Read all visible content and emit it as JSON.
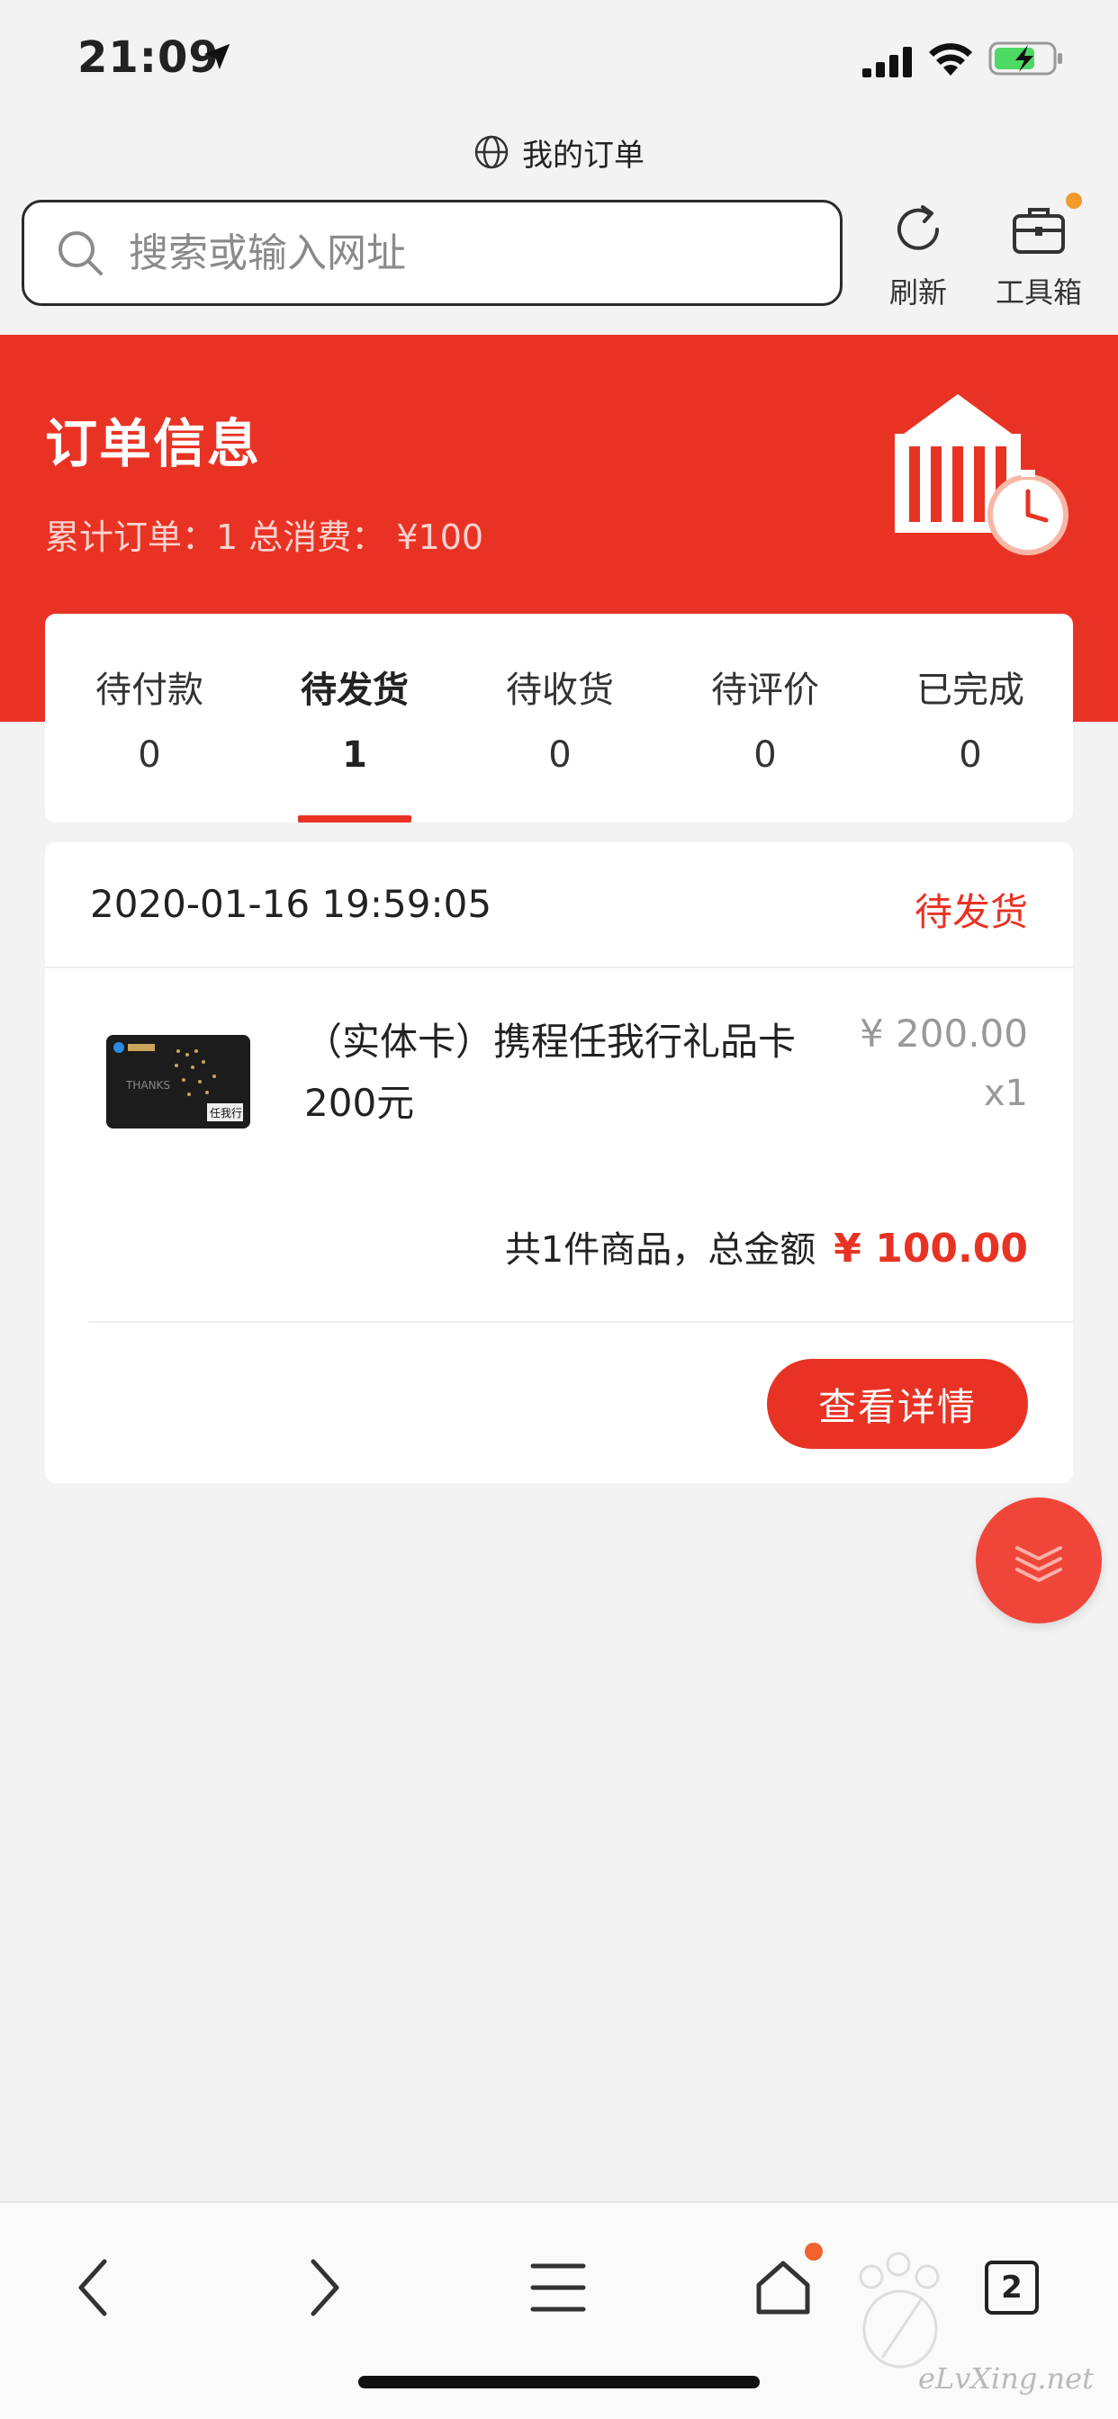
{
  "status_bar": {
    "time": "21:09"
  },
  "browser": {
    "page_title": "我的订单",
    "search_placeholder": "搜索或输入网址",
    "refresh_label": "刷新",
    "toolbox_label": "工具箱",
    "tab_count": "2"
  },
  "header": {
    "title": "订单信息",
    "summary": "累计订单：1 总消费： ¥100"
  },
  "tabs": [
    {
      "label": "待付款",
      "count": "0"
    },
    {
      "label": "待发货",
      "count": "1"
    },
    {
      "label": "待收货",
      "count": "0"
    },
    {
      "label": "待评价",
      "count": "0"
    },
    {
      "label": "已完成",
      "count": "0"
    }
  ],
  "order": {
    "date": "2020-01-16 19:59:05",
    "status": "待发货",
    "product_name": "（实体卡）携程任我行礼品卡200元",
    "product_price": "¥ 200.00",
    "product_qty": "x1",
    "total_label": "共1件商品，总金额",
    "total_amount": "¥ 100.00",
    "details_button": "查看详情",
    "card_text_1": "THANKS",
    "card_text_2": "任我行"
  },
  "watermark": "eLvXing.net",
  "colors": {
    "accent": "#e83324",
    "toolbox_dot": "#f39a2c"
  }
}
